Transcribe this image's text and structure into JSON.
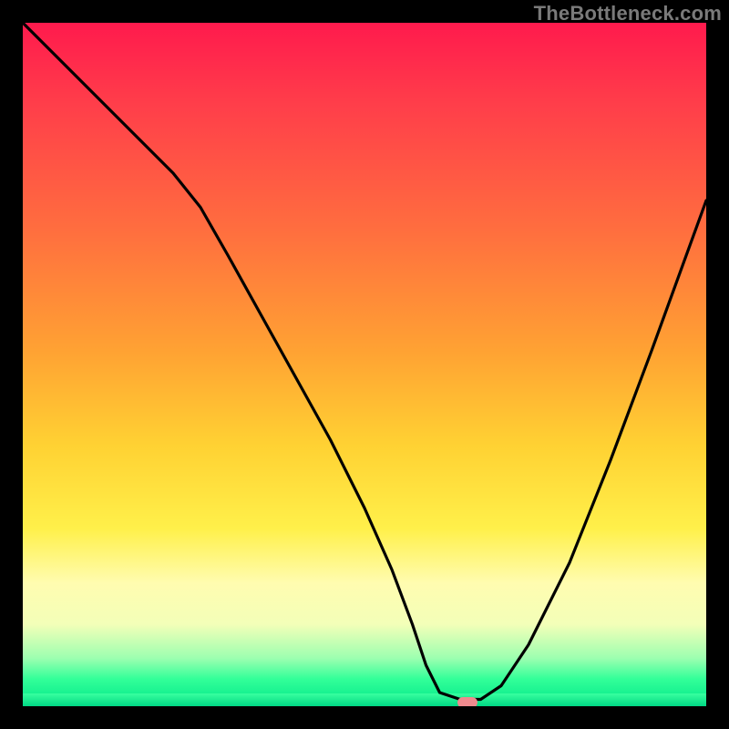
{
  "watermark": "TheBottleneck.com",
  "colors": {
    "frame": "#000000",
    "curve": "#000000",
    "marker": "#ef8a8e",
    "gradient_top": "#ff1a4d",
    "gradient_bottom": "#00d884"
  },
  "chart_data": {
    "type": "line",
    "title": "",
    "xlabel": "",
    "ylabel": "",
    "xlim": [
      0,
      100
    ],
    "ylim": [
      0,
      100
    ],
    "grid": false,
    "series": [
      {
        "name": "bottleneck_curve",
        "x": [
          0,
          6,
          12,
          18,
          22,
          26,
          30,
          35,
          40,
          45,
          50,
          54,
          57,
          59,
          61,
          64,
          67,
          70,
          74,
          80,
          86,
          92,
          100
        ],
        "y": [
          100,
          94,
          88,
          82,
          78,
          73,
          66,
          57,
          48,
          39,
          29,
          20,
          12,
          6,
          2,
          1,
          1,
          3,
          9,
          21,
          36,
          52,
          74
        ]
      }
    ],
    "marker": {
      "name": "optimal_point",
      "x": 65,
      "y": 0.5
    },
    "background": "vertical_gradient_red_to_green",
    "legend": false
  }
}
